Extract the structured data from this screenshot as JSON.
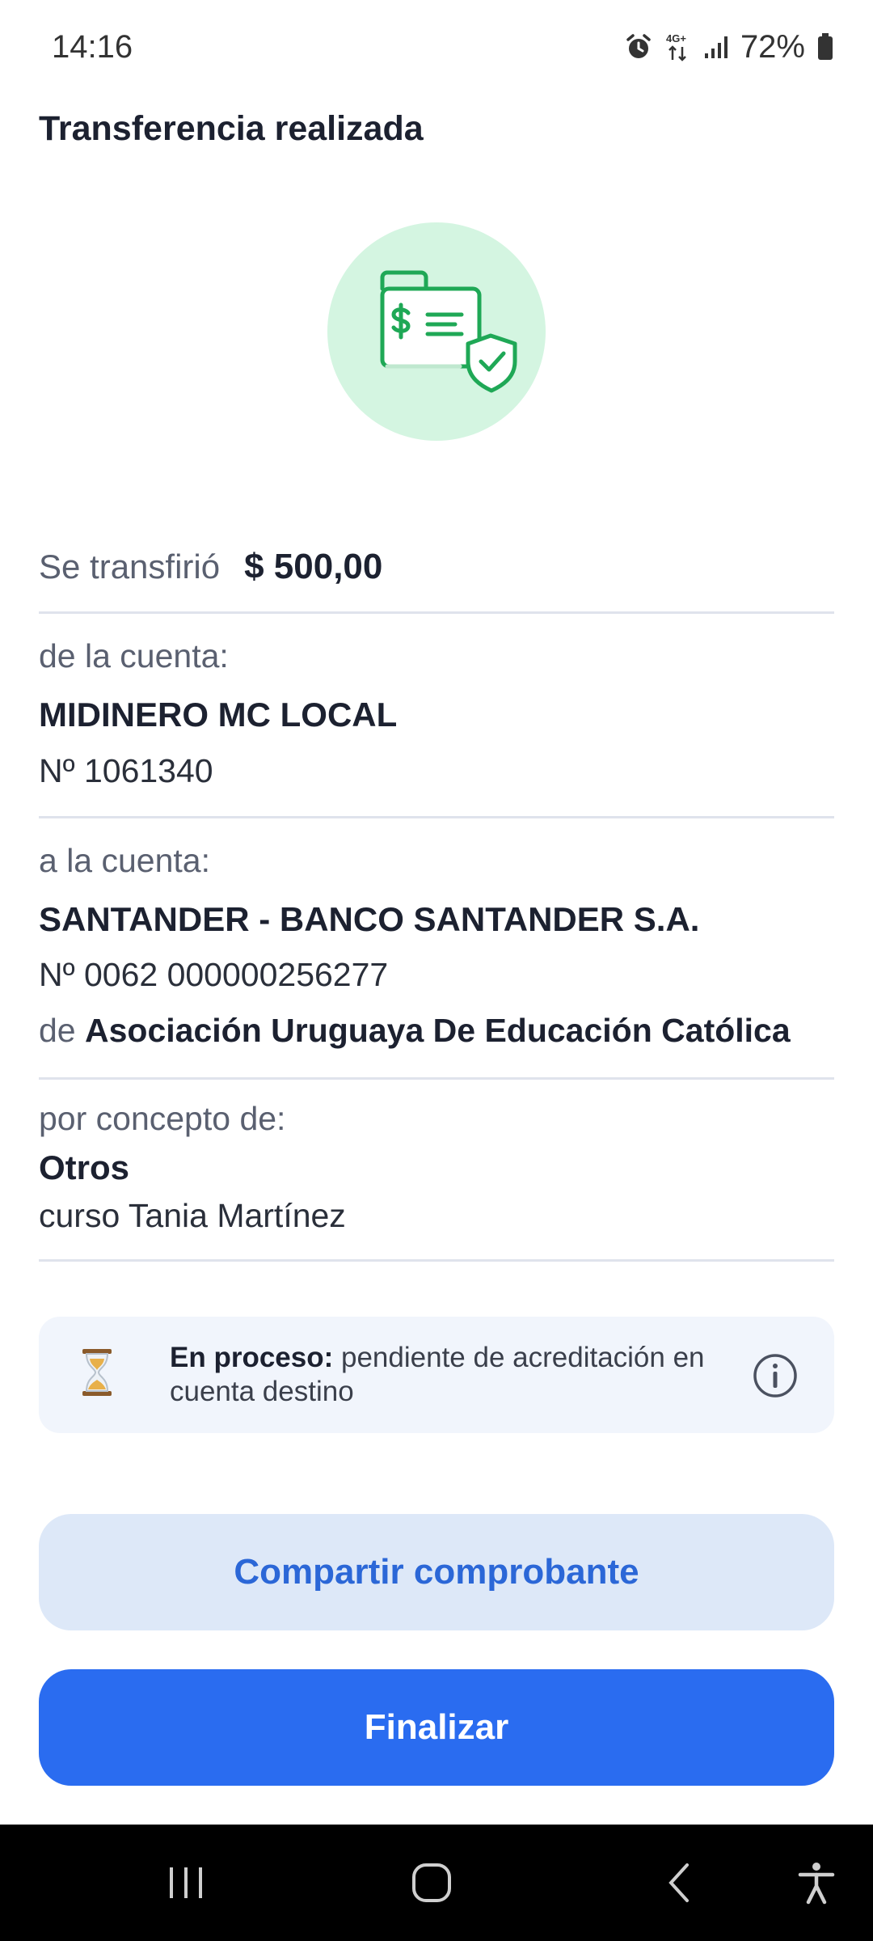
{
  "status_bar": {
    "time": "14:16",
    "network": "4G+",
    "battery": "72%",
    "icons": [
      "alarm-icon",
      "data-arrows-icon",
      "signal-icon",
      "battery-icon"
    ]
  },
  "header": {
    "title": "Transferencia realizada"
  },
  "hero": {
    "icon": "receipt-shield-check-icon",
    "accent": "#1fa856",
    "background": "#d4f5e1"
  },
  "amount": {
    "label": "Se transfirió",
    "value": "$ 500,00"
  },
  "from_account": {
    "label": "de la cuenta:",
    "name": "MIDINERO MC LOCAL",
    "number": "Nº 1061340"
  },
  "to_account": {
    "label": "a la cuenta:",
    "bank": "SANTANDER - BANCO SANTANDER S.A.",
    "number": "Nº 0062 000000256277",
    "owner_prefix": "de",
    "owner": "Asociación Uruguaya De Educación Católica"
  },
  "concept": {
    "label": "por concepto de:",
    "category": "Otros",
    "description": "curso Tania Martínez"
  },
  "notice": {
    "icon": "hourglass-icon",
    "title": "En proceso:",
    "text": "pendiente de acreditación en cuenta destino",
    "info_icon": "info-icon"
  },
  "buttons": {
    "share": "Compartir comprobante",
    "finish": "Finalizar"
  },
  "colors": {
    "primary": "#2a6cf0",
    "secondary_bg": "#dde8f8",
    "secondary_text": "#2b67d7"
  },
  "nav_bar": {
    "icons": [
      "recents-icon",
      "home-icon",
      "back-icon",
      "accessibility-icon"
    ]
  }
}
